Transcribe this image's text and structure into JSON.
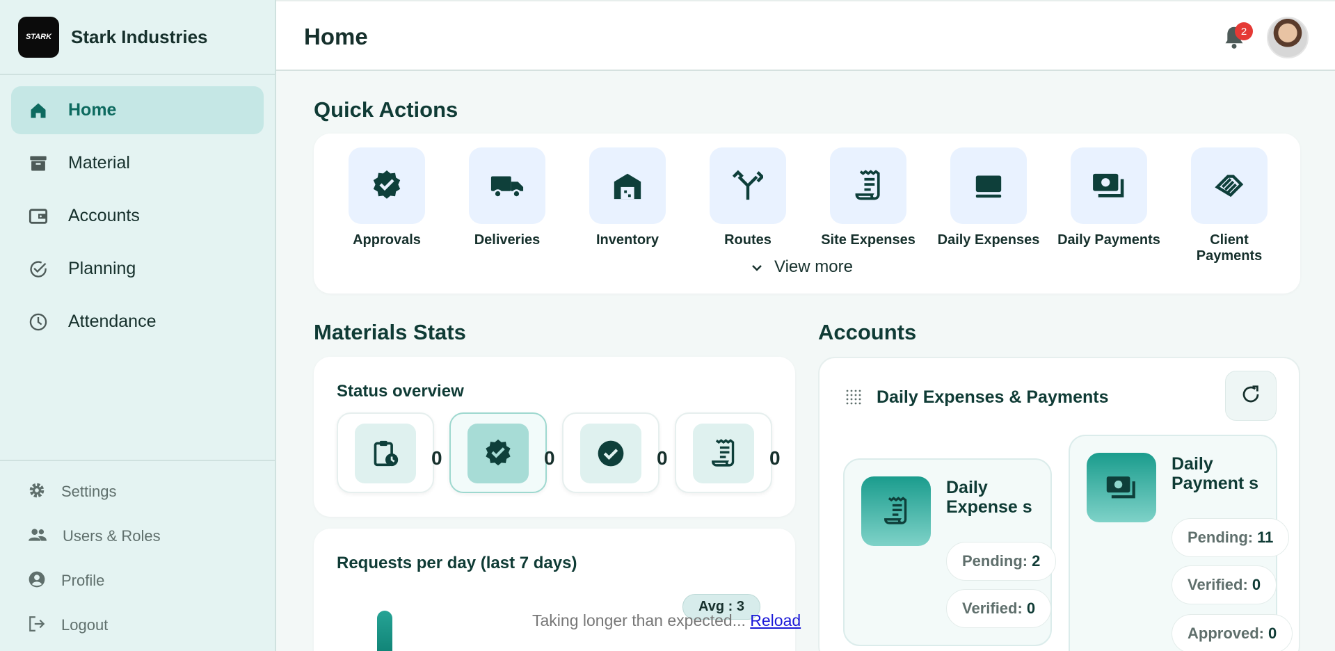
{
  "brand": {
    "name": "Stark Industries",
    "logo_text": "STARK"
  },
  "sidebar": {
    "items": [
      {
        "label": "Home",
        "icon": "home-icon",
        "active": true
      },
      {
        "label": "Material",
        "icon": "archive-icon"
      },
      {
        "label": "Accounts",
        "icon": "wallet-icon"
      },
      {
        "label": "Planning",
        "icon": "check-circle-icon"
      },
      {
        "label": "Attendance",
        "icon": "clock-icon"
      }
    ],
    "bottom": [
      {
        "label": "Settings",
        "icon": "gear-icon"
      },
      {
        "label": "Users & Roles",
        "icon": "users-icon"
      },
      {
        "label": "Profile",
        "icon": "user-circle-icon"
      },
      {
        "label": "Logout",
        "icon": "logout-icon"
      }
    ]
  },
  "header": {
    "title": "Home",
    "notification_count": "2"
  },
  "quick_actions": {
    "title": "Quick Actions",
    "items": [
      {
        "label": "Approvals",
        "icon": "verified-badge-icon"
      },
      {
        "label": "Deliveries",
        "icon": "truck-icon"
      },
      {
        "label": "Inventory",
        "icon": "warehouse-icon"
      },
      {
        "label": "Routes",
        "icon": "fork-icon"
      },
      {
        "label": "Site Expenses",
        "icon": "receipt-icon"
      },
      {
        "label": "Daily Expenses",
        "icon": "card-icon"
      },
      {
        "label": "Daily Payments",
        "icon": "money-icon"
      },
      {
        "label": "Client Payments",
        "icon": "handshake-icon"
      }
    ],
    "view_more": "View more"
  },
  "materials": {
    "title": "Materials Stats",
    "status_title": "Status overview",
    "stats": [
      {
        "value": "0",
        "icon": "clipboard-clock-icon"
      },
      {
        "value": "0",
        "icon": "verified-badge-icon",
        "selected": true
      },
      {
        "value": "0",
        "icon": "check-circle-icon"
      },
      {
        "value": "0",
        "icon": "receipt-icon"
      }
    ],
    "requests_title": "Requests per day (last 7 days)",
    "avg_label": "Avg : 3"
  },
  "loading": {
    "text": "Taking longer than expected...",
    "reload": "Reload"
  },
  "accounts": {
    "title": "Accounts",
    "card_title": "Daily Expenses & Payments",
    "expenses": {
      "title": "Daily Expense s",
      "pending_label": "Pending:",
      "pending": "2",
      "verified_label": "Verified:",
      "verified": "0"
    },
    "payments": {
      "title": "Daily Payment s",
      "pending_label": "Pending:",
      "pending": "11",
      "verified_label": "Verified:",
      "verified": "0",
      "approved_label": "Approved:",
      "approved": "0"
    }
  },
  "colors": {
    "accent": "#0d6a5f",
    "sidebar_bg": "#e4f3f2",
    "tile_bg": "#e9f2ff"
  }
}
